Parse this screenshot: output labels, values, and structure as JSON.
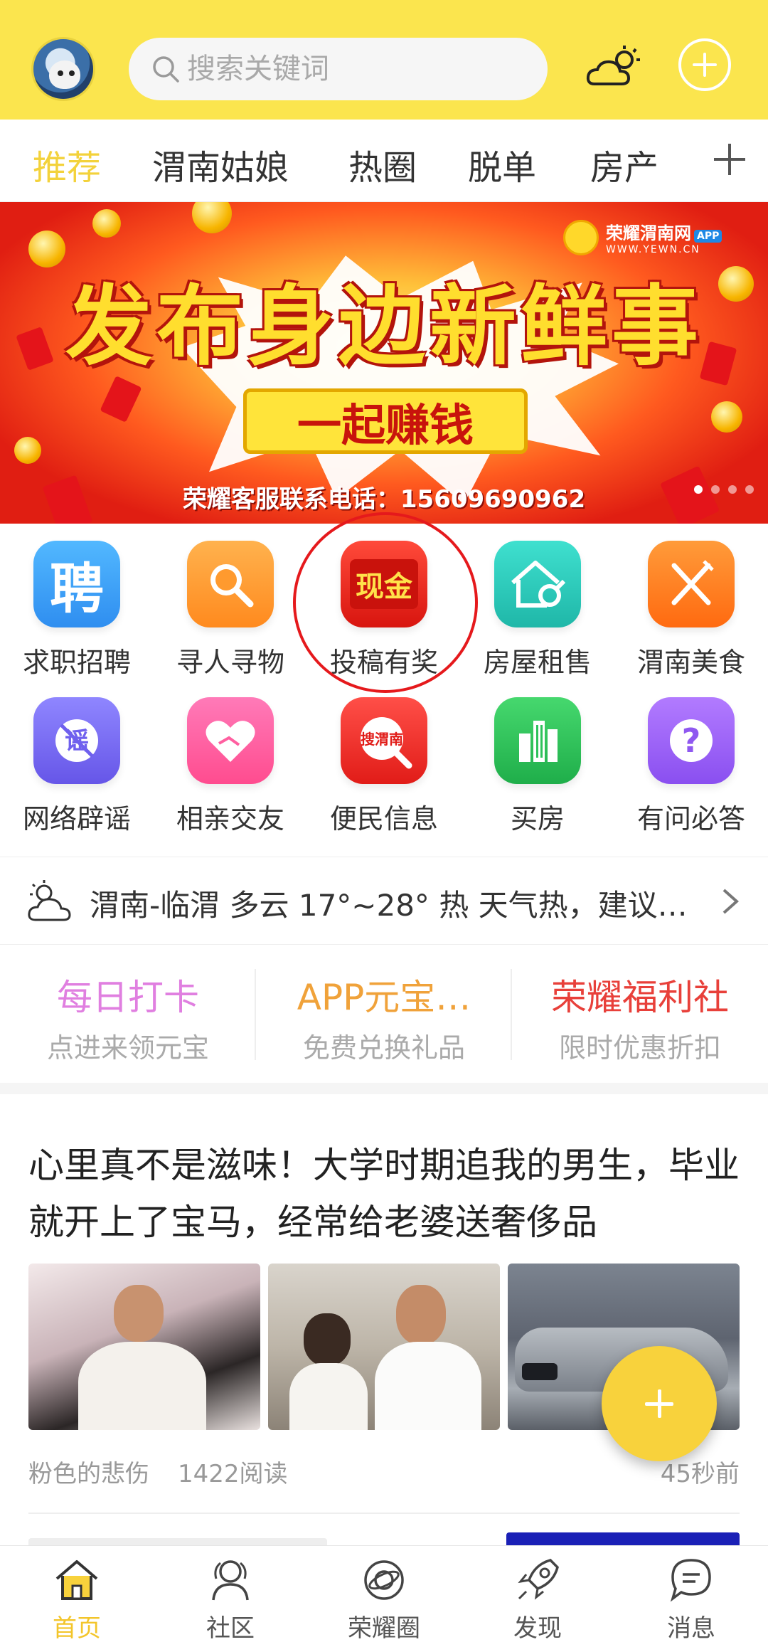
{
  "header": {
    "search_placeholder": "搜索关键词"
  },
  "tabs": [
    {
      "label": "推荐",
      "active": true
    },
    {
      "label": "渭南姑娘",
      "active": false
    },
    {
      "label": "热圈",
      "active": false
    },
    {
      "label": "脱单",
      "active": false
    },
    {
      "label": "房产",
      "active": false
    }
  ],
  "banner": {
    "title": "发布身边新鲜事",
    "button": "一起赚钱",
    "phone": "荣耀客服联系电话：15609690962",
    "logo_name": "荣耀渭南网",
    "logo_badge": "APP",
    "logo_url": "WWW.YEWN.CN"
  },
  "grid": [
    {
      "label": "求职招聘",
      "icon": "recruit-icon",
      "glyph": "聘",
      "color": "#2f9bf5"
    },
    {
      "label": "寻人寻物",
      "icon": "magnifier-icon",
      "glyph": "",
      "color": "#ff9a2e"
    },
    {
      "label": "投稿有奖",
      "icon": "cash-icon",
      "glyph": "现金",
      "color": "#e8261f"
    },
    {
      "label": "房屋租售",
      "icon": "house-key-icon",
      "glyph": "",
      "color": "#27c9b9"
    },
    {
      "label": "渭南美食",
      "icon": "fork-knife-icon",
      "glyph": "",
      "color": "#ff7f1e"
    },
    {
      "label": "网络辟谣",
      "icon": "rumor-icon",
      "glyph": "谣",
      "color": "#7c6df0"
    },
    {
      "label": "相亲交友",
      "icon": "heart-handshake-icon",
      "glyph": "",
      "color": "#ff5fa0"
    },
    {
      "label": "便民信息",
      "icon": "search-weinan-icon",
      "glyph": "搜渭南",
      "color": "#ef2d2a"
    },
    {
      "label": "买房",
      "icon": "buildings-icon",
      "glyph": "",
      "color": "#2ec25b"
    },
    {
      "label": "有问必答",
      "icon": "question-icon",
      "glyph": "?",
      "color": "#9b62f2"
    }
  ],
  "weather": {
    "text": "渭南-临渭 多云 17°~28° 热 天气热，建议…"
  },
  "promos": [
    {
      "title": "每日打卡",
      "subtitle": "点进来领元宝",
      "color": "#e07fe0"
    },
    {
      "title": "APP元宝…",
      "subtitle": "免费兑换礼品",
      "color": "#f0a23a"
    },
    {
      "title": "荣耀福利社",
      "subtitle": "限时优惠折扣",
      "color": "#e8403a"
    }
  ],
  "article": {
    "title": "心里真不是滋味！大学时期追我的男生，毕业就开上了宝马，经常给老婆送奢侈品",
    "author": "粉色的悲伤",
    "reads": "1422阅读",
    "time": "45秒前"
  },
  "bottom_nav": [
    {
      "label": "首页",
      "icon": "home-icon",
      "active": true
    },
    {
      "label": "社区",
      "icon": "community-icon",
      "active": false
    },
    {
      "label": "荣耀圈",
      "icon": "planet-icon",
      "active": false
    },
    {
      "label": "发现",
      "icon": "rocket-icon",
      "active": false
    },
    {
      "label": "消息",
      "icon": "message-icon",
      "active": false
    }
  ],
  "colors": {
    "header_bg": "#fbe54e",
    "accent": "#f3d23b",
    "banner_red": "#e01e12"
  }
}
